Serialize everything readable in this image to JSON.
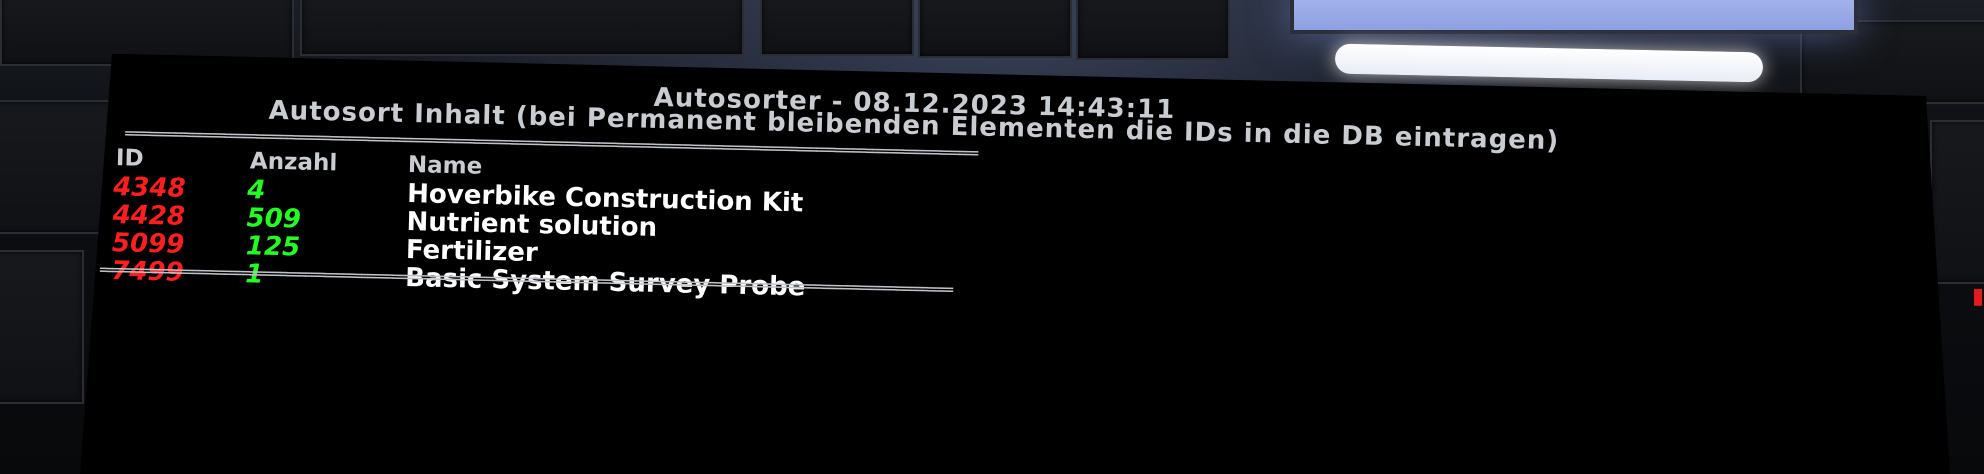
{
  "title": "Autosorter - 08.12.2023 14:43:11",
  "subtitle": "Autosort Inhalt (bei Permanent bleibenden Elementen die IDs in die DB eintragen)",
  "separator": "=========================================================================================================================================",
  "columns": {
    "id": "ID",
    "quantity": "Anzahl",
    "name": "Name"
  },
  "rows": [
    {
      "id": "4348",
      "quantity": "4",
      "name": "Hoverbike Construction Kit"
    },
    {
      "id": "4428",
      "quantity": "509",
      "name": "Nutrient solution"
    },
    {
      "id": "5099",
      "quantity": "125",
      "name": "Fertilizer"
    },
    {
      "id": "7499",
      "quantity": "1",
      "name": "Basic System Survey Probe"
    }
  ],
  "colors": {
    "id_text": "#ff1f1f",
    "quantity_text": "#22ff22",
    "name_text": "#ffffff",
    "header_text": "#c9ccd1",
    "screen_background": "#000000"
  }
}
